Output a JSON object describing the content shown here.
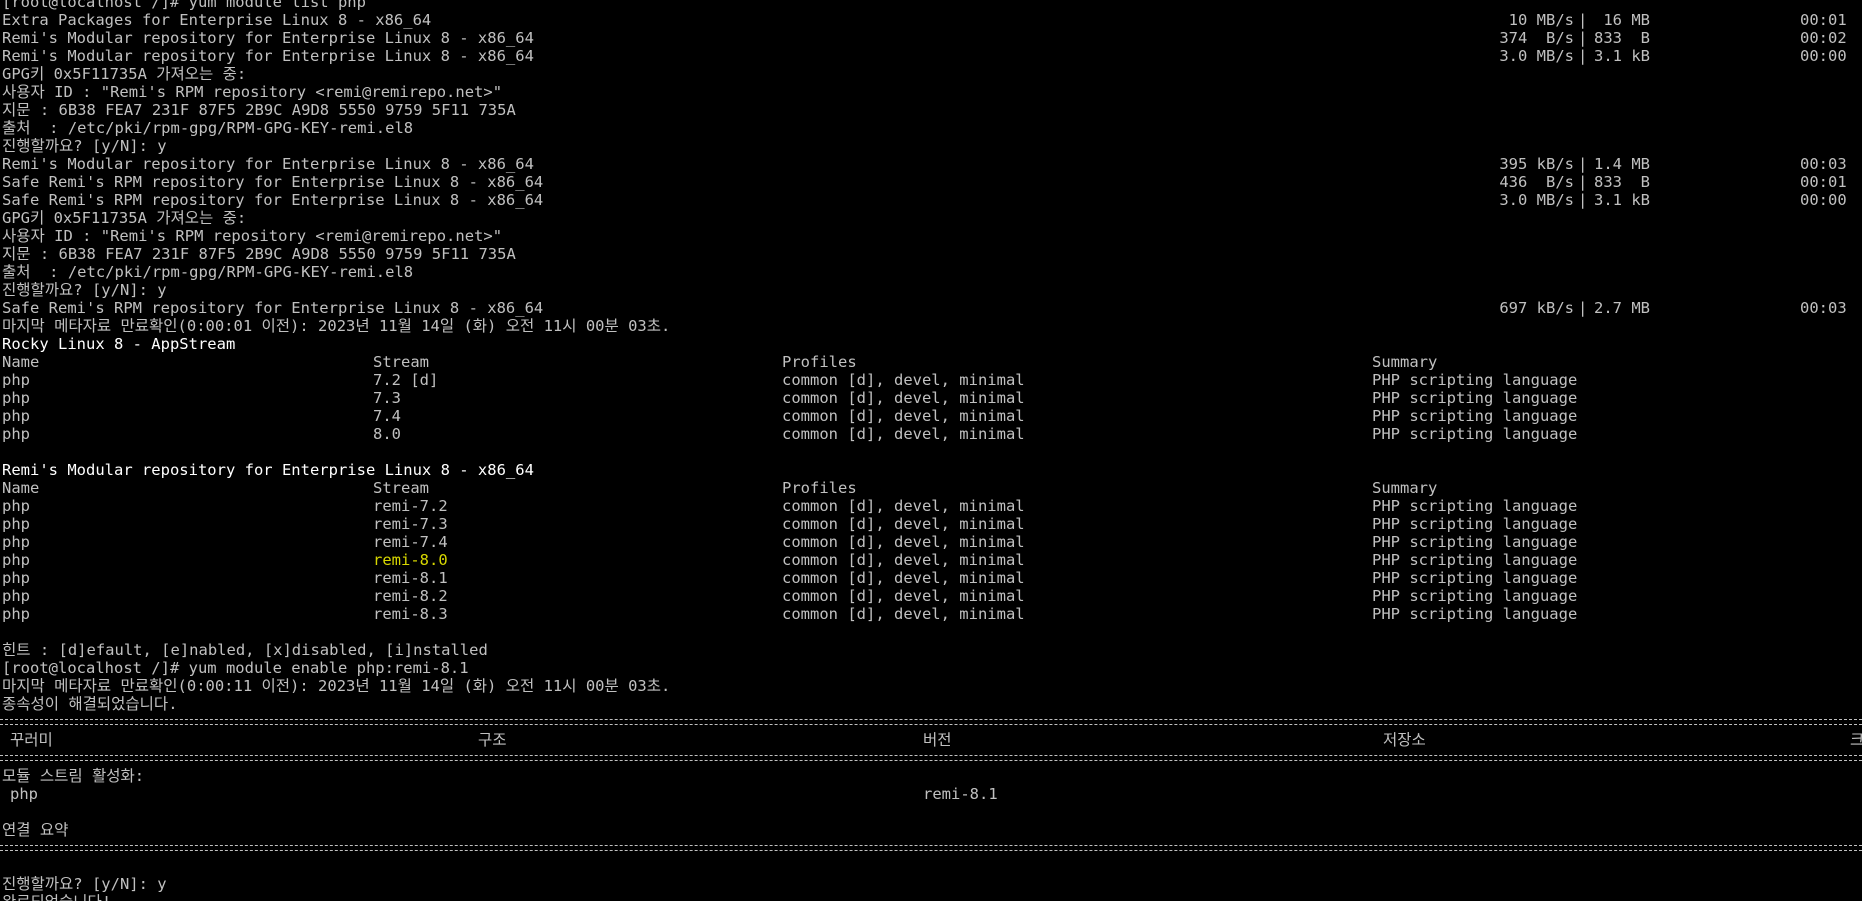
{
  "terminal": {
    "lines": {
      "cmd1": "[root@localhost /]# yum module list php",
      "dl1_name": "Extra Packages for Enterprise Linux 8 - x86_64",
      "dl1_speed": "10 MB/s",
      "dl1_size": "16 MB",
      "dl1_time": "00:01",
      "dl2_name": "Remi's Modular repository for Enterprise Linux 8 - x86_64",
      "dl2_speed": "374  B/s",
      "dl2_size": "833  B",
      "dl2_time": "00:02",
      "dl3_name": "Remi's Modular repository for Enterprise Linux 8 - x86_64",
      "dl3_speed": "3.0 MB/s",
      "dl3_size": "3.1 kB",
      "dl3_time": "00:00",
      "gpg1": "GPG키 0x5F11735A 가져오는 중:",
      "gpg1_user": "사용자 ID : \"Remi's RPM repository <remi@remirepo.net>\"",
      "gpg1_fp": "지문 : 6B38 FEA7 231F 87F5 2B9C A9D8 5550 9759 5F11 735A",
      "gpg1_src": "출처  : /etc/pki/rpm-gpg/RPM-GPG-KEY-remi.el8",
      "confirm1": "진행할까요? [y/N]: y",
      "dl4_name": "Remi's Modular repository for Enterprise Linux 8 - x86_64",
      "dl4_speed": "395 kB/s",
      "dl4_size": "1.4 MB",
      "dl4_time": "00:03",
      "dl5_name": "Safe Remi's RPM repository for Enterprise Linux 8 - x86_64",
      "dl5_speed": "436  B/s",
      "dl5_size": "833  B",
      "dl5_time": "00:01",
      "dl6_name": "Safe Remi's RPM repository for Enterprise Linux 8 - x86_64",
      "dl6_speed": "3.0 MB/s",
      "dl6_size": "3.1 kB",
      "dl6_time": "00:00",
      "gpg2": "GPG키 0x5F11735A 가져오는 중:",
      "gpg2_user": "사용자 ID : \"Remi's RPM repository <remi@remirepo.net>\"",
      "gpg2_fp": "지문 : 6B38 FEA7 231F 87F5 2B9C A9D8 5550 9759 5F11 735A",
      "gpg2_src": "출처  : /etc/pki/rpm-gpg/RPM-GPG-KEY-remi.el8",
      "confirm2": "진행할까요? [y/N]: y",
      "dl7_name": "Safe Remi's RPM repository for Enterprise Linux 8 - x86_64",
      "dl7_speed": "697 kB/s",
      "dl7_size": "2.7 MB",
      "dl7_time": "00:03",
      "meta1": "마지막 메타자료 만료확인(0:00:01 이전): 2023년 11월 14일 (화) 오전 11시 00분 03초.",
      "repo1_title": "Rocky Linux 8 - AppStream",
      "repo2_title": "Remi's Modular repository for Enterprise Linux 8 - x86_64",
      "hint": "힌트 : [d]efault, [e]nabled, [x]disabled, [i]nstalled",
      "cmd2": "[root@localhost /]# yum module enable php:remi-8.1",
      "meta2": "마지막 메타자료 만료확인(0:00:11 이전): 2023년 11월 14일 (화) 오전 11시 00분 03초.",
      "deps_resolved": "종속성이 해결되었습니다.",
      "enable_streams": "모듈 스트림 활성화:",
      "enable_pkg": "php",
      "enable_ver": "remi-8.1",
      "summary": "연결 요약",
      "confirm3": "진행할까요? [y/N]: y",
      "complete": "완료되었습니다!"
    },
    "headers": {
      "name": "Name",
      "stream": "Stream",
      "profiles": "Profiles",
      "summary": "Summary"
    },
    "txn_headers": {
      "package": "꾸러미",
      "arch": "구조",
      "version": "버전",
      "repo": "저장소",
      "size": "크기"
    },
    "repo1_rows": [
      {
        "name": "php",
        "stream": "7.2 [d]",
        "profiles": "common [d], devel, minimal",
        "summary": "PHP scripting language"
      },
      {
        "name": "php",
        "stream": "7.3",
        "profiles": "common [d], devel, minimal",
        "summary": "PHP scripting language"
      },
      {
        "name": "php",
        "stream": "7.4",
        "profiles": "common [d], devel, minimal",
        "summary": "PHP scripting language"
      },
      {
        "name": "php",
        "stream": "8.0",
        "profiles": "common [d], devel, minimal",
        "summary": "PHP scripting language"
      }
    ],
    "repo2_rows": [
      {
        "name": "php",
        "stream": "remi-7.2",
        "profiles": "common [d], devel, minimal",
        "summary": "PHP scripting language"
      },
      {
        "name": "php",
        "stream": "remi-7.3",
        "profiles": "common [d], devel, minimal",
        "summary": "PHP scripting language"
      },
      {
        "name": "php",
        "stream": "remi-7.4",
        "profiles": "common [d], devel, minimal",
        "summary": "PHP scripting language"
      },
      {
        "name": "php",
        "stream": "remi-8.0",
        "profiles": "common [d], devel, minimal",
        "summary": "PHP scripting language"
      },
      {
        "name": "php",
        "stream": "remi-8.1",
        "profiles": "common [d], devel, minimal",
        "summary": "PHP scripting language"
      },
      {
        "name": "php",
        "stream": "remi-8.2",
        "profiles": "common [d], devel, minimal",
        "summary": "PHP scripting language"
      },
      {
        "name": "php",
        "stream": "remi-8.3",
        "profiles": "common [d], devel, minimal",
        "summary": "PHP scripting language"
      }
    ],
    "sep": "|",
    "colors": {
      "background": "#000000",
      "text": "#c0c0c0",
      "bright": "#ffffff",
      "highlight": "#d7d700"
    }
  }
}
